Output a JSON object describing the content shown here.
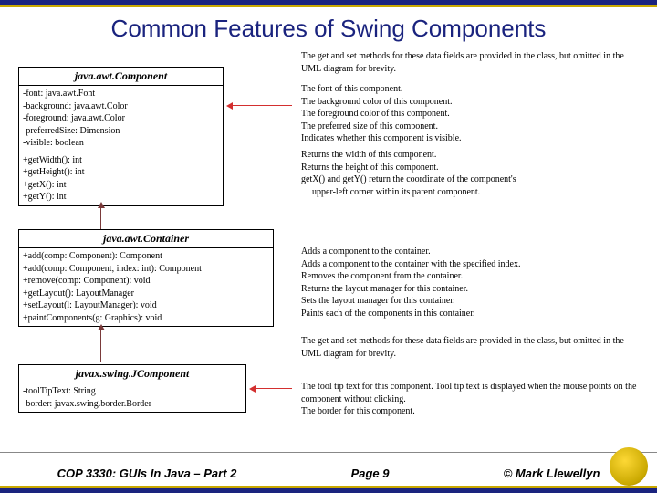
{
  "title": "Common Features of Swing Components",
  "component": {
    "name": "java.awt.Component",
    "fields": [
      "-font: java.awt.Font",
      "-background: java.awt.Color",
      "-foreground: java.awt.Color",
      "-preferredSize: Dimension",
      "-visible: boolean"
    ],
    "methods": [
      "+getWidth(): int",
      "+getHeight(): int",
      "+getX(): int",
      "+getY(): int"
    ],
    "note": "The get and set methods for these data fields are provided in the class, but omitted in the UML diagram for brevity.",
    "fieldDesc": [
      "The font of this component.",
      "The background color of this component.",
      "The foreground color of this component.",
      "The preferred size of this component.",
      "Indicates whether this component is visible."
    ],
    "methodDesc": [
      "Returns the width of this component.",
      "Returns the height of this component.",
      "getX() and getY() return the coordinate of the component's",
      "upper-left corner within its parent component."
    ]
  },
  "container": {
    "name": "java.awt.Container",
    "methods": [
      "+add(comp: Component): Component",
      "+add(comp: Component, index: int): Component",
      "+remove(comp: Component): void",
      "+getLayout(): LayoutManager",
      "+setLayout(l: LayoutManager): void",
      "+paintComponents(g: Graphics): void"
    ],
    "methodDesc": [
      "Adds a component to the container.",
      "Adds a component to the container with the specified index.",
      "Removes the component from the container.",
      "Returns the layout manager for this container.",
      "Sets the layout manager for this container.",
      "Paints each of the components in this container."
    ]
  },
  "jcomponent": {
    "name": "javax.swing.JComponent",
    "fields": [
      "-toolTipText: String",
      "-border: javax.swing.border.Border"
    ],
    "note": "The get and set methods for these data fields are provided in the class, but omitted in the UML diagram for brevity.",
    "fieldDesc": [
      "The tool tip text for this component. Tool tip text is displayed when the mouse points on the component without clicking.",
      "The border for this component."
    ]
  },
  "footer": {
    "course": "COP 3330:  GUIs In Java – Part 2",
    "page": "Page 9",
    "copyright": "© Mark Llewellyn"
  }
}
